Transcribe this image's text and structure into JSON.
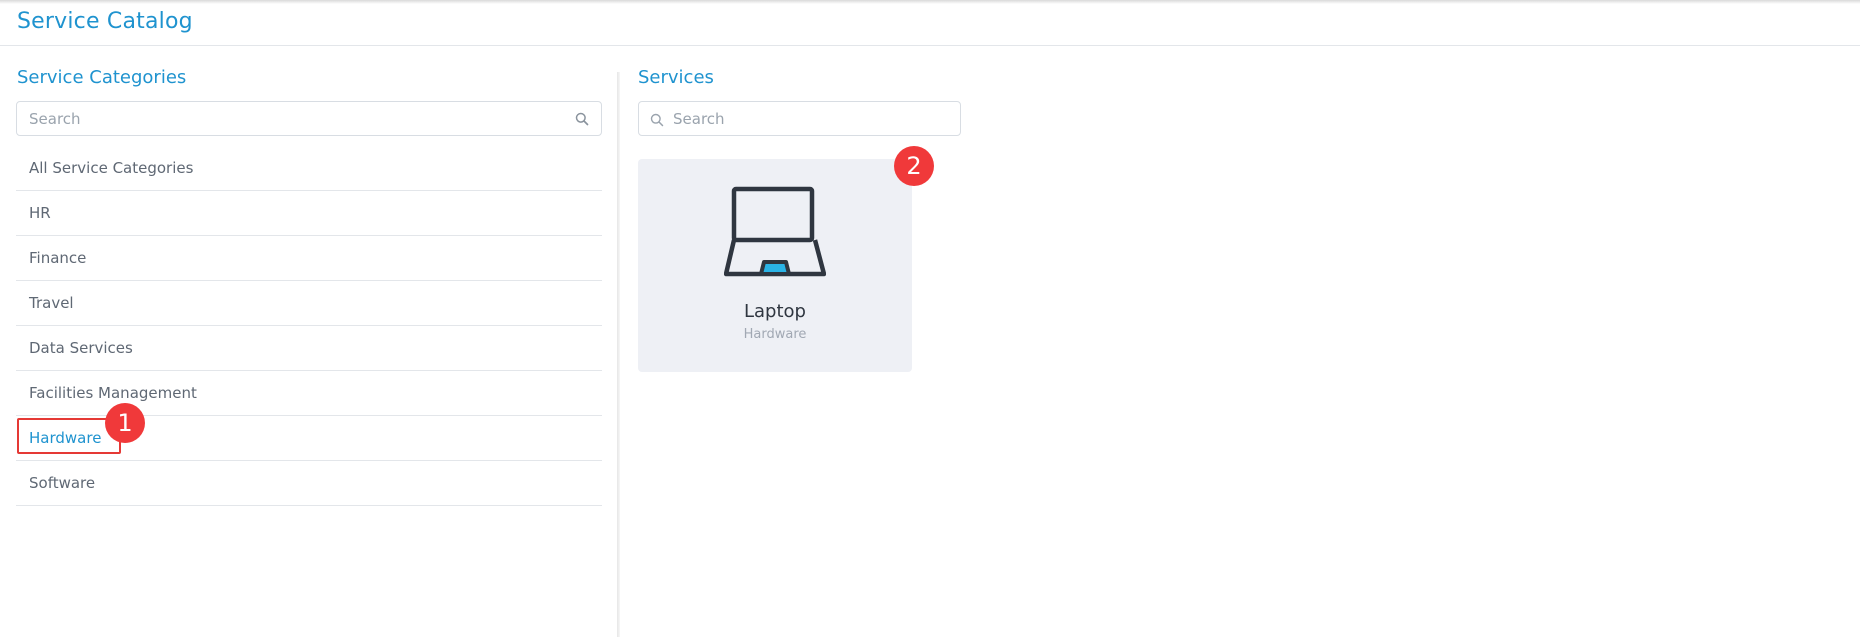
{
  "page": {
    "title": "Service Catalog"
  },
  "categories_panel": {
    "heading": "Service Categories",
    "search_placeholder": "Search",
    "items": [
      {
        "label": "All Service Categories"
      },
      {
        "label": "HR"
      },
      {
        "label": "Finance"
      },
      {
        "label": "Travel"
      },
      {
        "label": "Data Services"
      },
      {
        "label": "Facilities Management"
      },
      {
        "label": "Hardware",
        "active": true
      },
      {
        "label": "Software"
      }
    ]
  },
  "services_panel": {
    "heading": "Services",
    "search_placeholder": "Search",
    "cards": [
      {
        "name": "Laptop",
        "category": "Hardware",
        "icon": "laptop-icon"
      }
    ]
  },
  "annotations": [
    {
      "number": "1"
    },
    {
      "number": "2"
    }
  ],
  "colors": {
    "accent": "#1f93cf",
    "badge": "#f0393a",
    "highlight_border": "#e53935",
    "card_bg": "#eef0f5",
    "icon_fill": "#2ab3e6"
  }
}
